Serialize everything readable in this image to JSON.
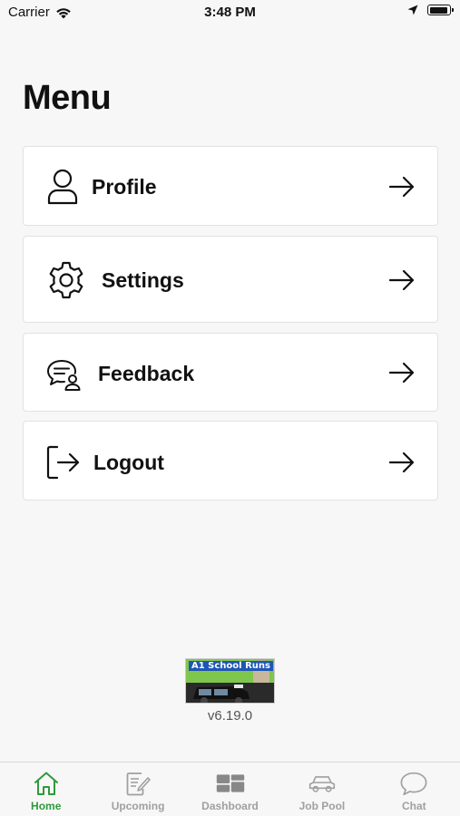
{
  "status_bar": {
    "carrier": "Carrier",
    "time": "3:48 PM",
    "battery_level": 0.95
  },
  "page": {
    "title": "Menu"
  },
  "menu": {
    "items": [
      {
        "label": "Profile",
        "icon": "person-icon"
      },
      {
        "label": "Settings",
        "icon": "gear-icon"
      },
      {
        "label": "Feedback",
        "icon": "feedback-chat-icon"
      },
      {
        "label": "Logout",
        "icon": "logout-icon"
      }
    ]
  },
  "footer": {
    "logo_text": "A1 School Runs",
    "version": "v6.19.0"
  },
  "tabs": [
    {
      "label": "Home",
      "icon": "home-icon",
      "active": true
    },
    {
      "label": "Upcoming",
      "icon": "notepad-pencil-icon",
      "active": false
    },
    {
      "label": "Dashboard",
      "icon": "dashboard-icon",
      "active": false
    },
    {
      "label": "Job Pool",
      "icon": "car-icon",
      "active": false
    },
    {
      "label": "Chat",
      "icon": "chat-bubble-icon",
      "active": false
    }
  ],
  "colors": {
    "active_tab": "#2e9a3c",
    "inactive_tab": "#a0a0a0",
    "background": "#f7f7f7"
  }
}
